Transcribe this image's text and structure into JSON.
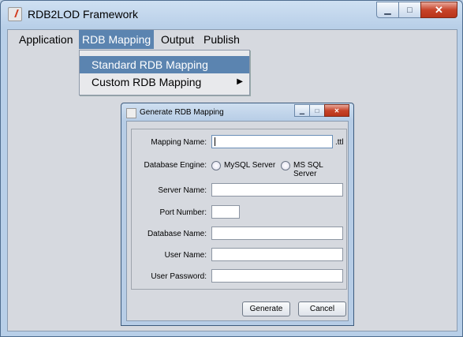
{
  "window": {
    "title": "RDB2LOD Framework"
  },
  "menubar": {
    "items": [
      "Application",
      "RDB Mapping",
      "Output",
      "Publish"
    ],
    "active": "RDB Mapping"
  },
  "dropdown": {
    "items": [
      {
        "label": "Standard RDB Mapping",
        "highlighted": true
      },
      {
        "label": "Custom RDB Mapping",
        "submenu": true
      }
    ]
  },
  "dialog": {
    "title": "Generate RDB Mapping",
    "fields": {
      "mapping_name": {
        "label": "Mapping Name:",
        "value": "",
        "suffix": ".ttl"
      },
      "database_engine": {
        "label": "Database Engine:",
        "options": [
          "MySQL Server",
          "MS SQL Server"
        ]
      },
      "server_name": {
        "label": "Server Name:",
        "value": ""
      },
      "port_number": {
        "label": "Port Number:",
        "value": ""
      },
      "database_name": {
        "label": "Database Name:",
        "value": ""
      },
      "user_name": {
        "label": "User Name:",
        "value": ""
      },
      "user_password": {
        "label": "User Password:",
        "value": ""
      }
    },
    "buttons": {
      "generate": "Generate",
      "cancel": "Cancel"
    }
  },
  "colors": {
    "menu_highlight": "#5b84b0",
    "close_button": "#c7442a"
  }
}
